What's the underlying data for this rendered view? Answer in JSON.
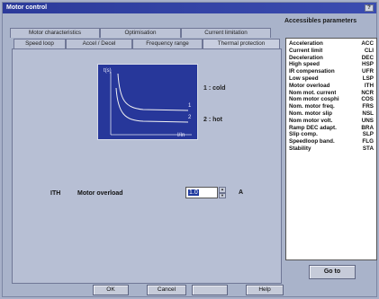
{
  "window": {
    "title": "Motor control",
    "help_label": "?"
  },
  "tabs_back": [
    {
      "label": "Motor characteristics"
    },
    {
      "label": "Optimisation"
    },
    {
      "label": "Current limitation"
    }
  ],
  "tabs_front": [
    {
      "label": "Speed loop"
    },
    {
      "label": "Accel / Decel"
    },
    {
      "label": "Frequency range"
    },
    {
      "label": "Thermal protection"
    }
  ],
  "graph": {
    "y_label": "t(s)",
    "x_label": "I/In",
    "curve1_marker": "1",
    "curve2_marker": "2",
    "legend1": "1 : cold",
    "legend2": "2 : hot"
  },
  "ith": {
    "code": "ITH",
    "name": "Motor overload",
    "value": "1.0",
    "unit": "A"
  },
  "side": {
    "title": "Accessibles parameters",
    "params": [
      {
        "name": "Acceleration",
        "code": "ACC"
      },
      {
        "name": "Current limit",
        "code": "CLI"
      },
      {
        "name": "Deceleration",
        "code": "DEC"
      },
      {
        "name": "High speed",
        "code": "HSP"
      },
      {
        "name": "IR compensation",
        "code": "UFR"
      },
      {
        "name": "Low speed",
        "code": "LSP"
      },
      {
        "name": "Motor overload",
        "code": "ITH"
      },
      {
        "name": "Nom mot. current",
        "code": "NCR"
      },
      {
        "name": "Nom motor cosphi",
        "code": "COS"
      },
      {
        "name": "Nom. motor freq.",
        "code": "FRS"
      },
      {
        "name": "Nom. motor slip",
        "code": "NSL"
      },
      {
        "name": "Nom motor volt.",
        "code": "UNS"
      },
      {
        "name": "Ramp DEC adapt.",
        "code": "BRA"
      },
      {
        "name": "Slip comp.",
        "code": "SLP"
      },
      {
        "name": "Speedloop band.",
        "code": "FLG"
      },
      {
        "name": "Stability",
        "code": "STA"
      }
    ],
    "goto_label": "Go to"
  },
  "buttons": {
    "ok": "OK",
    "cancel": "Cancel",
    "apply": "",
    "help": "Help"
  }
}
